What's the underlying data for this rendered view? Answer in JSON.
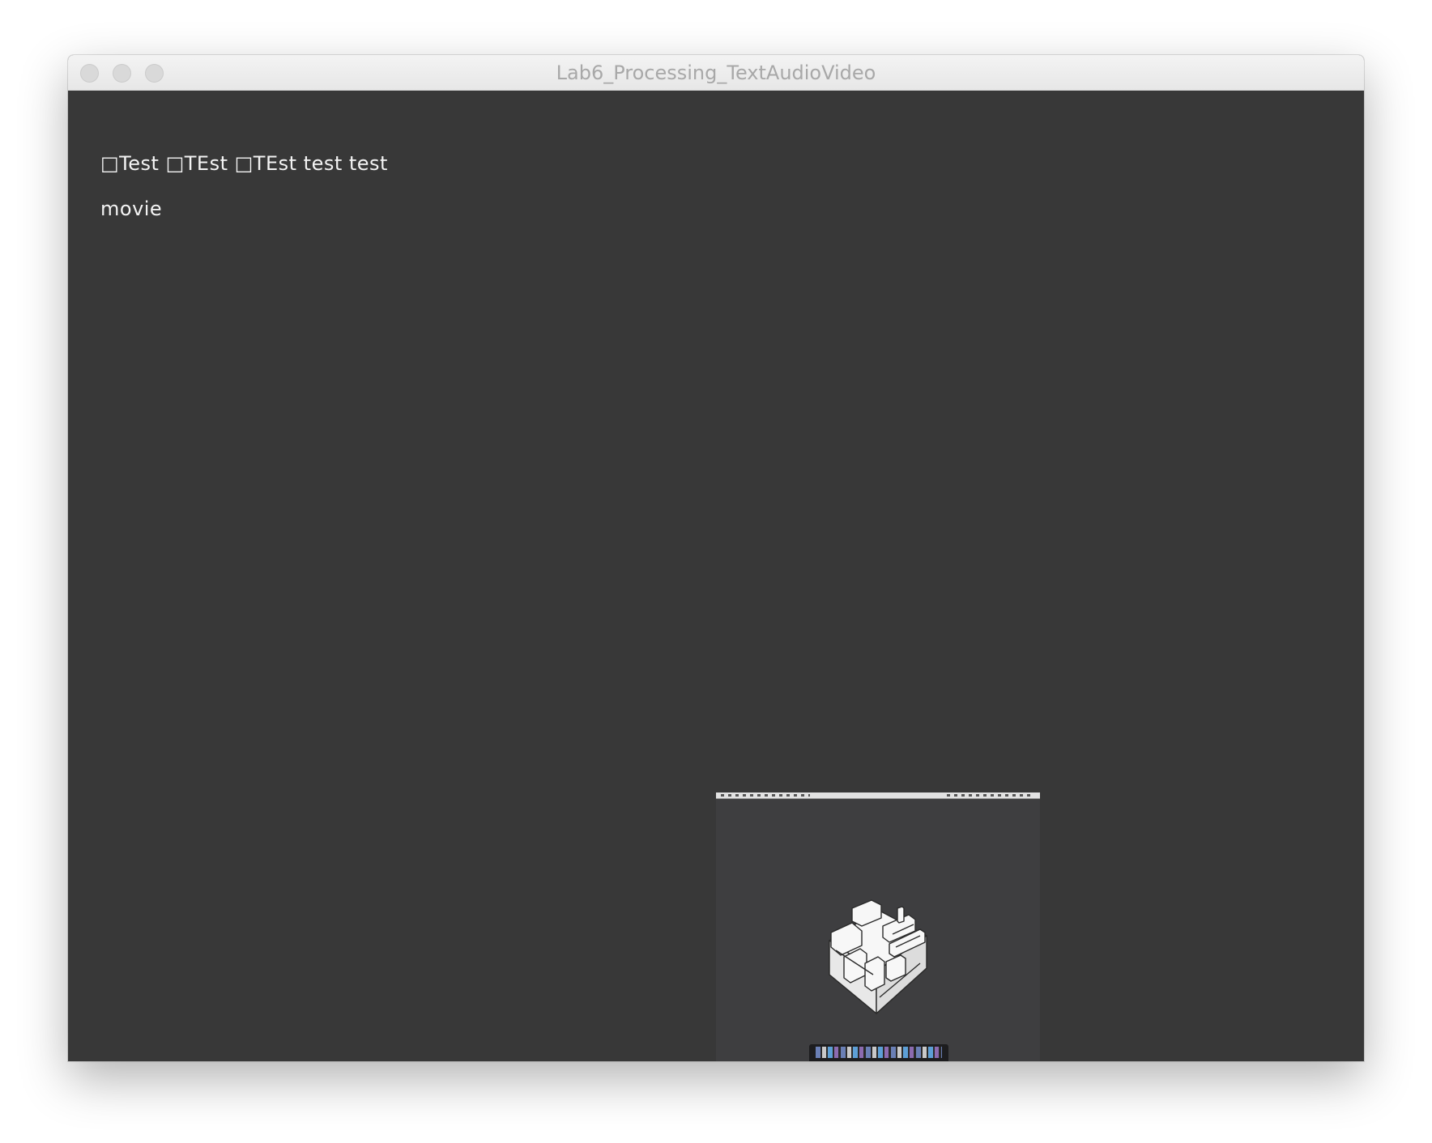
{
  "window": {
    "title": "Lab6_Processing_TextAudioVideo"
  },
  "canvas": {
    "text_line": "□Test □TEst □TEst test test",
    "movie_label": "movie"
  },
  "colors": {
    "canvas_background": "#383838",
    "text": "#f4f4f4",
    "titlebar": "#ececec"
  },
  "video": {
    "description_icon": "arduino-board-icon"
  }
}
